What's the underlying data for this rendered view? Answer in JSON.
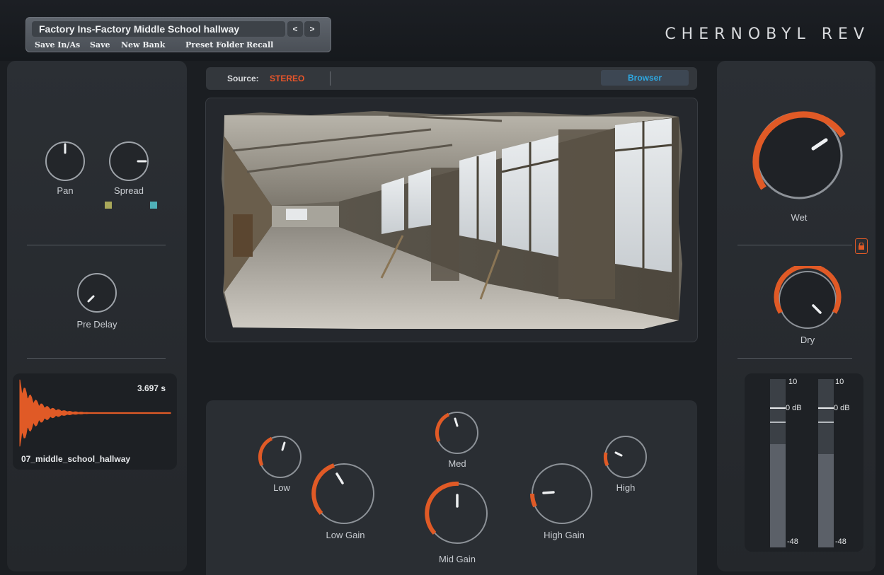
{
  "header": {
    "preset_name": "Factory Ins-Factory Middle School hallway",
    "prev_label": "<",
    "next_label": ">",
    "menu": [
      "Save In/As",
      "Save",
      "New Bank",
      "Preset Folder",
      "Recall"
    ],
    "brand": "CHERNOBYL REV"
  },
  "left": {
    "pan_label": "Pan",
    "spread_label": "Spread",
    "predelay_label": "Pre Delay",
    "spread_colors": [
      "#a9a85a",
      "#4fb0b8"
    ],
    "ir_time": "3.697 s",
    "ir_name": "07_middle_school_hallway",
    "ir_color": "#e05a26"
  },
  "center": {
    "source_label": "Source:",
    "source_value": "STEREO",
    "browser_label": "Browser"
  },
  "eq": {
    "low_label": "Low",
    "low_gain_label": "Low Gain",
    "med_label": "Med",
    "mid_gain_label": "Mid Gain",
    "high_gain_label": "High Gain",
    "high_label": "High"
  },
  "right": {
    "wet_label": "Wet",
    "dry_label": "Dry",
    "meter_top": "10",
    "meter_zero": "0 dB",
    "meter_bottom": "-48"
  },
  "colors": {
    "accent": "#e05a26",
    "link": "#2ea7e0",
    "background": "#1b1e22"
  },
  "icons": [
    "lock-icon",
    "chevron-left-icon",
    "chevron-right-icon"
  ]
}
